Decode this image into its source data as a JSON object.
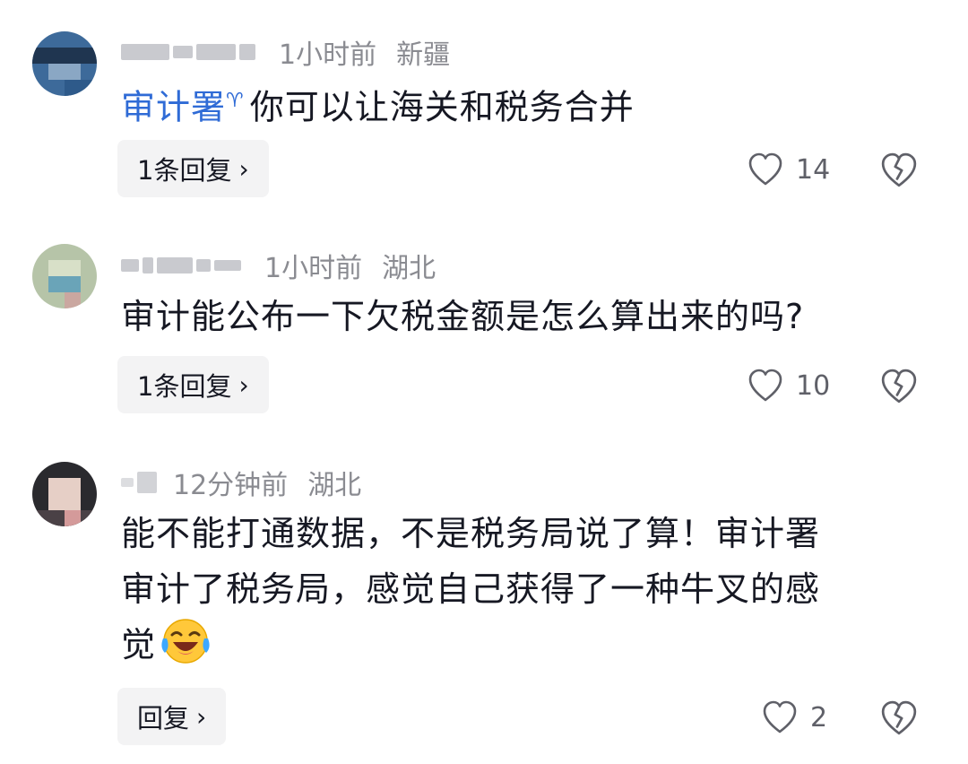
{
  "comments": [
    {
      "time": "1小时前",
      "location": "新疆",
      "mention": "审计署",
      "text": "你可以让海关和税务合并",
      "reply_label": "1条回复",
      "likes": "14"
    },
    {
      "time": "1小时前",
      "location": "湖北",
      "text": "审计能公布一下欠税金额是怎么算出来的吗?",
      "reply_label": "1条回复",
      "likes": "10"
    },
    {
      "time": "12分钟前",
      "location": "湖北",
      "text_line1": "能不能打通数据，不是税务局说了算！审计署",
      "text_line2": "审计了税务局，感觉自己获得了一种牛叉的感",
      "text_line3": "觉",
      "emoji": "laughing-crying-emoji",
      "reply_label": "回复",
      "likes": "2"
    }
  ],
  "icons": {
    "chevron": "chevron-right-icon",
    "like": "heart-outline-icon",
    "dislike": "broken-heart-icon"
  },
  "colors": {
    "mention": "#2f6bd6",
    "meta": "#8a8b91",
    "reply_bg": "#f3f3f4"
  }
}
